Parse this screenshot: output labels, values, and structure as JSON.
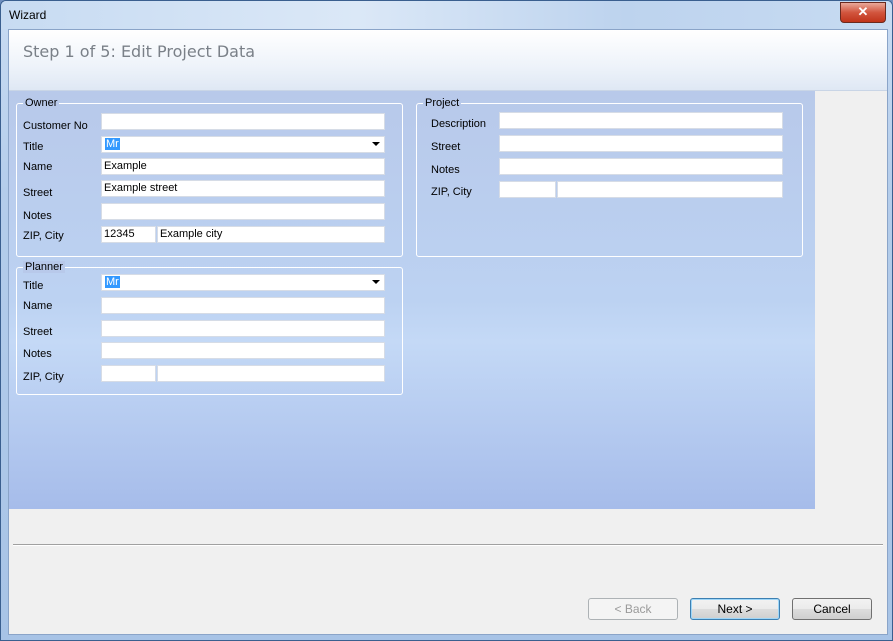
{
  "window": {
    "title": "Wizard",
    "close_label": "✕"
  },
  "header": {
    "step_title": "Step 1 of 5: Edit Project Data"
  },
  "owner": {
    "group_label": "Owner",
    "customer_no_label": "Customer No",
    "customer_no_value": "",
    "title_label": "Title",
    "title_value": "Mr",
    "name_label": "Name",
    "name_value": "Example",
    "street_label": "Street",
    "street_value": "Example street",
    "notes_label": "Notes",
    "notes_value": "",
    "zip_city_label": "ZIP, City",
    "zip_value": "12345",
    "city_value": "Example city"
  },
  "planner": {
    "group_label": "Planner",
    "title_label": "Title",
    "title_value": "Mr",
    "name_label": "Name",
    "name_value": "",
    "street_label": "Street",
    "street_value": "",
    "notes_label": "Notes",
    "notes_value": "",
    "zip_city_label": "ZIP, City",
    "zip_value": "",
    "city_value": ""
  },
  "project": {
    "group_label": "Project",
    "description_label": "Description",
    "description_value": "",
    "street_label": "Street",
    "street_value": "",
    "notes_label": "Notes",
    "notes_value": "",
    "zip_city_label": "ZIP, City",
    "zip_value": "",
    "city_value": ""
  },
  "footer": {
    "back_label": "< Back",
    "next_label": "Next >",
    "cancel_label": "Cancel"
  }
}
